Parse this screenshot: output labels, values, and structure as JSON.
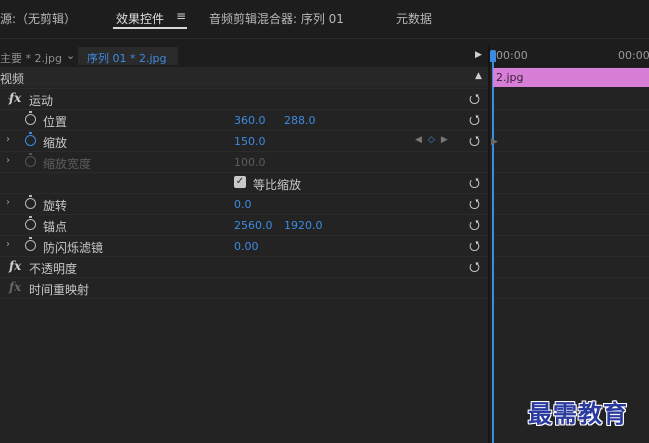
{
  "tabs": {
    "source": "源:（无剪辑）",
    "effect_controls": "效果控件",
    "menu_glyph": "≡",
    "audio_mixer": "音频剪辑混合器: 序列 01",
    "metadata": "元数据"
  },
  "sequence_bar": {
    "source_clip": "主要 * 2.jpg",
    "chevron": "⌄",
    "sequence_clip": "序列 01 * 2.jpg",
    "play_glyph": "▶"
  },
  "video_header": {
    "label": "视频",
    "collapse_glyph": "▲"
  },
  "effects": {
    "motion": {
      "fx": "fx",
      "label": "运动"
    },
    "position": {
      "label": "位置",
      "x": "360.0",
      "y": "288.0"
    },
    "scale": {
      "label": "缩放",
      "value": "150.0",
      "keyframe_prev": "◀",
      "keyframe_add": "◇",
      "keyframe_next": "▶"
    },
    "scale_width": {
      "label": "缩放宽度",
      "value": "100.0"
    },
    "uniform_scale": {
      "label": "等比缩放",
      "checked": "✓"
    },
    "rotation": {
      "label": "旋转",
      "value": "0.0"
    },
    "anchor": {
      "label": "锚点",
      "x": "2560.0",
      "y": "1920.0"
    },
    "antiflicker": {
      "label": "防闪烁滤镜",
      "value": "0.00"
    },
    "opacity": {
      "fx": "fx",
      "label": "不透明度"
    },
    "time_remap": {
      "fx": "fx",
      "label": "时间重映射"
    }
  },
  "reset_glyph": "⭯",
  "twisty_glyph": "›",
  "timeline": {
    "tick_start": "00:00",
    "tick_end": "00:00",
    "clip_name": "2.jpg"
  },
  "watermark": "最需教育",
  "colors": {
    "accent": "#3d8be0",
    "clip": "#d77fd6",
    "background": "#232323"
  }
}
